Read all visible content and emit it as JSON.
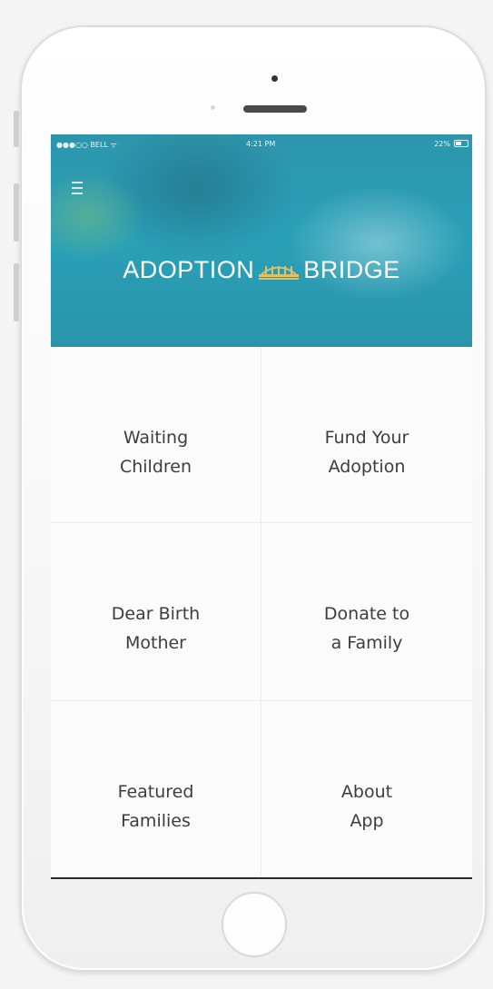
{
  "status_bar": {
    "carrier": "●●●○○ BELL ᯤ",
    "time": "4:21 PM",
    "battery": "22%"
  },
  "header": {
    "logo_left": "ADOPTION",
    "logo_right": "BRIDGE"
  },
  "menu": [
    {
      "line1": "Waiting",
      "line2": "Children",
      "accent": "#3a9fc0"
    },
    {
      "line1": "Fund Your",
      "line2": "Adoption",
      "accent": "#a7ad86"
    },
    {
      "line1": "Dear Birth",
      "line2": "Mother",
      "accent": "#b4b88f"
    },
    {
      "line1": "Donate to",
      "line2": "a Family",
      "accent": "#3aa0c2"
    },
    {
      "line1": "Featured",
      "line2": "Families",
      "accent": "#3a9fc0"
    },
    {
      "line1": "About",
      "line2": "App",
      "accent": "#a7ad86"
    }
  ],
  "colors": {
    "brand_teal": "#2a9bb3",
    "bridge_gold": "#d9c26a"
  },
  "icons": {
    "menu": "hamburger-icon",
    "logo": "bridge-icon",
    "battery": "battery-icon"
  }
}
